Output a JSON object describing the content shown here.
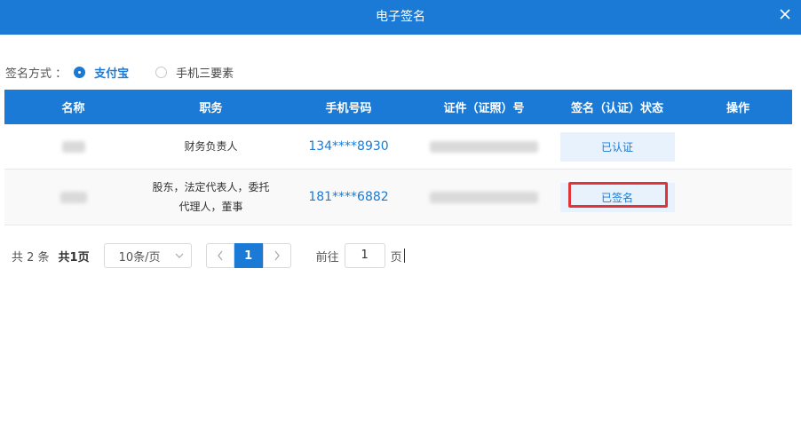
{
  "dialog": {
    "title": "电子签名"
  },
  "sign_method": {
    "label": "签名方式 ：",
    "options": [
      {
        "label": "支付宝",
        "selected": true
      },
      {
        "label": "手机三要素",
        "selected": false
      }
    ]
  },
  "table": {
    "headers": [
      "名称",
      "职务",
      "手机号码",
      "证件（证照）号",
      "签名（认证）状态",
      "操作"
    ],
    "rows": [
      {
        "duty_lines": [
          "财务负责人"
        ],
        "phone": "134****8930",
        "status": "已认证"
      },
      {
        "duty_lines": [
          "股东，法定代表人，委托",
          "代理人，董事"
        ],
        "phone": "181****6882",
        "status": "已签名"
      }
    ]
  },
  "pagination": {
    "total": "共 2 条",
    "pages": "共1页",
    "page_size": "10条/页",
    "current_page": "1",
    "goto_label": "前往",
    "goto_value": "1",
    "goto_unit": "页"
  },
  "colors": {
    "primary": "#1a7ad6",
    "highlight_border": "#e0343a"
  }
}
